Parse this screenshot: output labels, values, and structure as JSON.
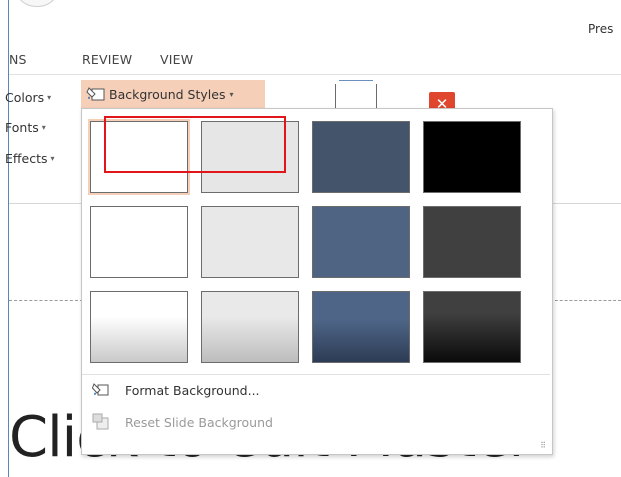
{
  "window": {
    "title_fragment": "Pres"
  },
  "ribbon_tabs": [
    {
      "label": "NS"
    },
    {
      "label": "REVIEW"
    },
    {
      "label": "VIEW"
    }
  ],
  "ribbon": {
    "colors_label": "Colors",
    "fonts_label": "Fonts",
    "effects_label": "Effects",
    "background_styles_label": "Background Styles",
    "caret": "▾",
    "close_master_glyph": "✕"
  },
  "background_styles_menu": {
    "styles": [
      {
        "id": "Style 1",
        "fill": "#ffffff"
      },
      {
        "id": "Style 2",
        "fill": "#e6e6e6"
      },
      {
        "id": "Style 3",
        "fill": "#44546a"
      },
      {
        "id": "Style 4",
        "fill": "#000000"
      },
      {
        "id": "Style 5",
        "fill": "#ffffff"
      },
      {
        "id": "Style 6",
        "fill": "#e9e8e8"
      },
      {
        "id": "Style 7",
        "fill": "#4f6383"
      },
      {
        "id": "Style 8",
        "fill": "#404040"
      },
      {
        "id": "Style 9",
        "fill": "linear-gradient(#ffffff 35%, #c9c9c9)"
      },
      {
        "id": "Style 10",
        "fill": "linear-gradient(#e9e9e9 35%, #bdbdbd)"
      },
      {
        "id": "Style 11",
        "fill": "linear-gradient(#4e6587 40%, #2d3c55)"
      },
      {
        "id": "Style 12",
        "fill": "linear-gradient(#404040 30%, #0a0a0a)"
      }
    ],
    "selected_index": 0,
    "format_background_label": "Format Background...",
    "reset_slide_background_label": "Reset Slide Background"
  },
  "slide": {
    "title_text": "Click to edit Master"
  },
  "colors": {
    "accent_highlight": "#f6cfb9",
    "annotation_red": "#e0161a",
    "window_accent": "#5b86b8"
  }
}
